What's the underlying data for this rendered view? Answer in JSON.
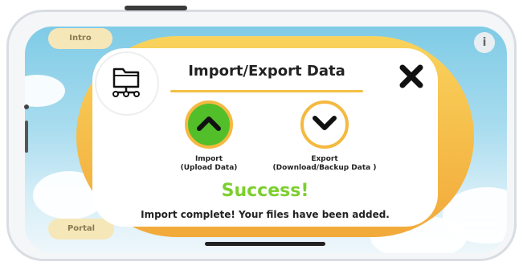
{
  "background": {
    "top_left_button": "Intro",
    "bottom_left_button": "Portal",
    "info_icon": "info-icon",
    "menu_icon": "hamburger-menu-icon"
  },
  "dialog": {
    "title": "Import/Export Data",
    "folder_icon": "folder-network-icon",
    "close_icon": "close-x-icon",
    "import": {
      "label_line1": "Import",
      "label_line2": "(Upload Data)",
      "icon": "chevron-up-icon"
    },
    "export": {
      "label_line1": "Export",
      "label_line2": "(Download/Backup Data )",
      "icon": "chevron-down-icon"
    },
    "status": "Success!",
    "message": "Import complete! Your files have been added."
  },
  "colors": {
    "accent_yellow": "#f4c145",
    "import_green": "#52be2a",
    "success_green": "#7ccf2e"
  }
}
